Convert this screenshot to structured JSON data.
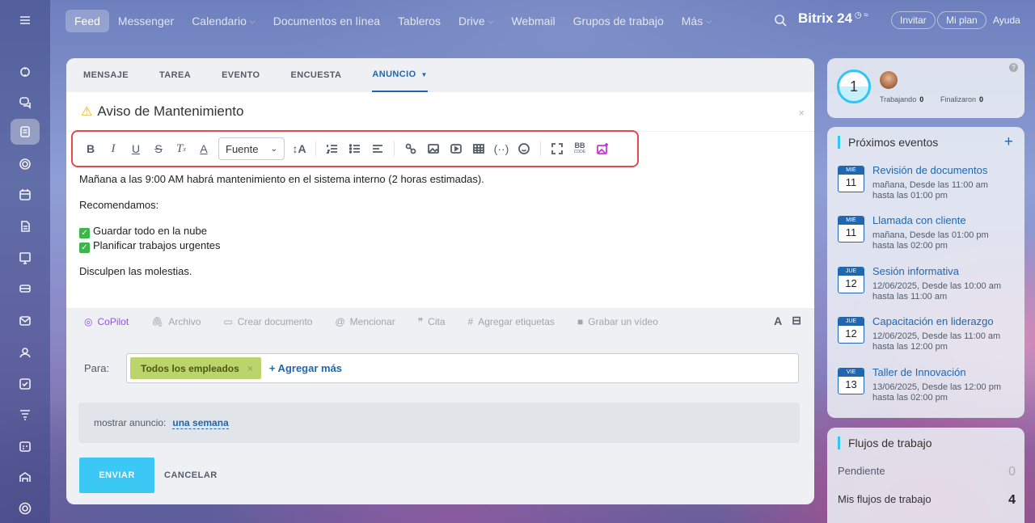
{
  "topnav": {
    "items": [
      {
        "label": "Feed"
      },
      {
        "label": "Messenger"
      },
      {
        "label": "Calendario"
      },
      {
        "label": "Documentos en línea"
      },
      {
        "label": "Tableros"
      },
      {
        "label": "Drive"
      },
      {
        "label": "Webmail"
      },
      {
        "label": "Grupos de trabajo"
      },
      {
        "label": "Más"
      }
    ],
    "brand": "Bitrix 24",
    "invite": "Invitar",
    "plan": "Mi plan",
    "help": "Ayuda"
  },
  "composer": {
    "tabs": [
      "MENSAJE",
      "TAREA",
      "EVENTO",
      "ENCUESTA",
      "ANUNCIO"
    ],
    "title": "Aviso de Mantenimiento",
    "toolbar": {
      "font_label": "Fuente",
      "bb_label": "BB",
      "code_label": "CODE"
    },
    "body": {
      "line1": "Mañana a las 9:00 AM habrá mantenimiento en el sistema interno (2 horas estimadas).",
      "line2": "Recomendamos:",
      "check1": "Guardar todo en la nube",
      "check2": "Planificar trabajos urgentes",
      "line3": "Disculpen las molestias."
    },
    "actions": {
      "copilot": "CoPilot",
      "file": "Archivo",
      "create_doc": "Crear documento",
      "mention": "Mencionar",
      "quote": "Cita",
      "tags": "Agregar etiquetas",
      "video": "Grabar un vídeo"
    },
    "to_label": "Para:",
    "recipient": "Todos los empleados",
    "add_more": "+ Agregar más",
    "show_label": "mostrar anuncio:",
    "show_value": "una semana",
    "send": "ENVIAR",
    "cancel": "CANCELAR"
  },
  "status_panel": {
    "counter": "1",
    "working_label": "Trabajando",
    "working_count": "0",
    "finished_label": "Finalizaron",
    "finished_count": "0"
  },
  "events": {
    "title": "Próximos eventos",
    "items": [
      {
        "weekday": "MIÉ",
        "day": "11",
        "title": "Revisión de documentos",
        "line1": "mañana, Desde las 11:00 am",
        "line2": "hasta las 01:00 pm"
      },
      {
        "weekday": "MIÉ",
        "day": "11",
        "title": "Llamada con cliente",
        "line1": "mañana, Desde las 01:00 pm",
        "line2": "hasta las 02:00 pm"
      },
      {
        "weekday": "JUE",
        "day": "12",
        "title": "Sesión informativa",
        "line1": "12/06/2025, Desde las 10:00 am",
        "line2": "hasta las 11:00 am"
      },
      {
        "weekday": "JUE",
        "day": "12",
        "title": "Capacitación en liderazgo",
        "line1": "12/06/2025, Desde las 11:00 am",
        "line2": "hasta las 12:00 pm"
      },
      {
        "weekday": "VIE",
        "day": "13",
        "title": "Taller de Innovación",
        "line1": "13/06/2025, Desde las 12:00 pm",
        "line2": "hasta las 02:00 pm"
      }
    ]
  },
  "workflows": {
    "title": "Flujos de trabajo",
    "pending_label": "Pendiente",
    "pending_count": "0",
    "mine_label": "Mis flujos de trabajo",
    "mine_count": "4"
  },
  "colors": {
    "accent": "#2067b0",
    "send_button": "#3bc8f5",
    "highlight_border": "#e5484d",
    "chip": "#bcd46c"
  }
}
